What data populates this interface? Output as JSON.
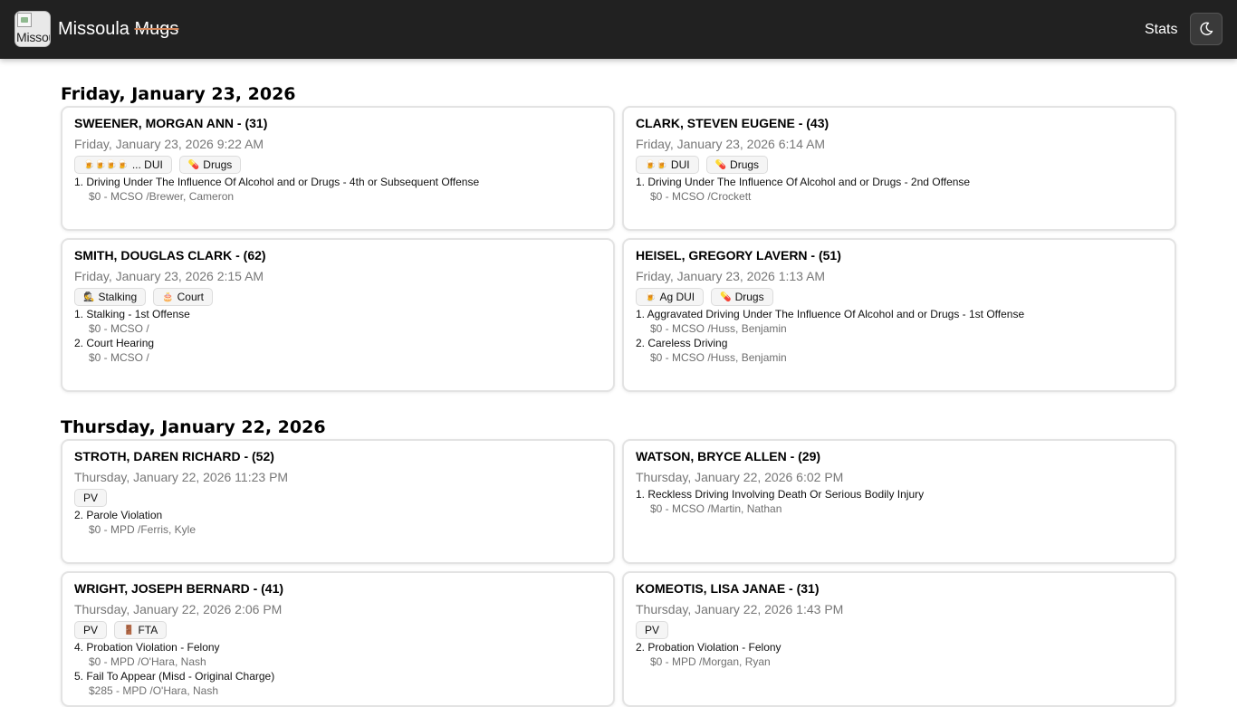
{
  "header": {
    "logo_alt": "Missoula",
    "brand_left": "Missoula",
    "brand_struck": "Mugs",
    "stats_label": "Stats"
  },
  "days": [
    {
      "heading": "Friday, January 23, 2026",
      "cards": [
        {
          "name": "SWEENER, MORGAN ANN - (31)",
          "time": "Friday, January 23, 2026 9:22 AM",
          "badges": [
            {
              "icon": "🍺🍺🍺🍺",
              "label": "... DUI"
            },
            {
              "icon": "💊",
              "label": "Drugs"
            }
          ],
          "charges": [
            {
              "text": "1. Driving Under The Influence Of Alcohol and or Drugs - 4th or Subsequent Offense",
              "detail": "$0 - MCSO /Brewer, Cameron"
            }
          ]
        },
        {
          "name": "CLARK, STEVEN EUGENE - (43)",
          "time": "Friday, January 23, 2026 6:14 AM",
          "badges": [
            {
              "icon": "🍺🍺",
              "label": "DUI"
            },
            {
              "icon": "💊",
              "label": "Drugs"
            }
          ],
          "charges": [
            {
              "text": "1. Driving Under The Influence Of Alcohol and or Drugs - 2nd Offense",
              "detail": "$0 - MCSO /Crockett"
            }
          ]
        },
        {
          "name": "SMITH, DOUGLAS CLARK - (62)",
          "time": "Friday, January 23, 2026 2:15 AM",
          "badges": [
            {
              "icon": "🕵",
              "label": "Stalking"
            },
            {
              "icon": "🎂",
              "label": "Court"
            }
          ],
          "charges": [
            {
              "text": "1. Stalking - 1st Offense",
              "detail": "$0 - MCSO /"
            },
            {
              "text": "2. Court Hearing",
              "detail": "$0 - MCSO /"
            }
          ]
        },
        {
          "name": "HEISEL, GREGORY LAVERN - (51)",
          "time": "Friday, January 23, 2026 1:13 AM",
          "badges": [
            {
              "icon": "🍺",
              "label": "Ag DUI"
            },
            {
              "icon": "💊",
              "label": "Drugs"
            }
          ],
          "charges": [
            {
              "text": "1. Aggravated Driving Under The Influence Of Alcohol and or Drugs - 1st Offense",
              "detail": "$0 - MCSO /Huss, Benjamin"
            },
            {
              "text": "2. Careless Driving",
              "detail": "$0 - MCSO /Huss, Benjamin"
            }
          ]
        }
      ]
    },
    {
      "heading": "Thursday, January 22, 2026",
      "cards": [
        {
          "name": "STROTH, DAREN RICHARD - (52)",
          "time": "Thursday, January 22, 2026 11:23 PM",
          "badges": [
            {
              "icon": "",
              "label": "PV"
            }
          ],
          "charges": [
            {
              "text": "2. Parole Violation",
              "detail": "$0 - MPD /Ferris, Kyle"
            }
          ]
        },
        {
          "name": "WATSON, BRYCE ALLEN - (29)",
          "time": "Thursday, January 22, 2026 6:02 PM",
          "badges": [],
          "charges": [
            {
              "text": "1. Reckless Driving Involving Death Or Serious Bodily Injury",
              "detail": "$0 - MCSO /Martin, Nathan"
            }
          ]
        },
        {
          "name": "WRIGHT, JOSEPH BERNARD - (41)",
          "time": "Thursday, January 22, 2026 2:06 PM",
          "badges": [
            {
              "icon": "",
              "label": "PV"
            },
            {
              "icon": "🚪",
              "label": "FTA"
            }
          ],
          "charges": [
            {
              "text": "4. Probation Violation - Felony",
              "detail": "$0 - MPD /O'Hara, Nash"
            },
            {
              "text": "5. Fail To Appear (Misd - Original Charge)",
              "detail": "$285 - MPD /O'Hara, Nash"
            }
          ]
        },
        {
          "name": "KOMEOTIS, LISA JANAE - (31)",
          "time": "Thursday, January 22, 2026 1:43 PM",
          "badges": [
            {
              "icon": "",
              "label": "PV"
            }
          ],
          "charges": [
            {
              "text": "2. Probation Violation - Felony",
              "detail": "$0 - MPD /Morgan, Ryan"
            }
          ]
        }
      ]
    }
  ]
}
